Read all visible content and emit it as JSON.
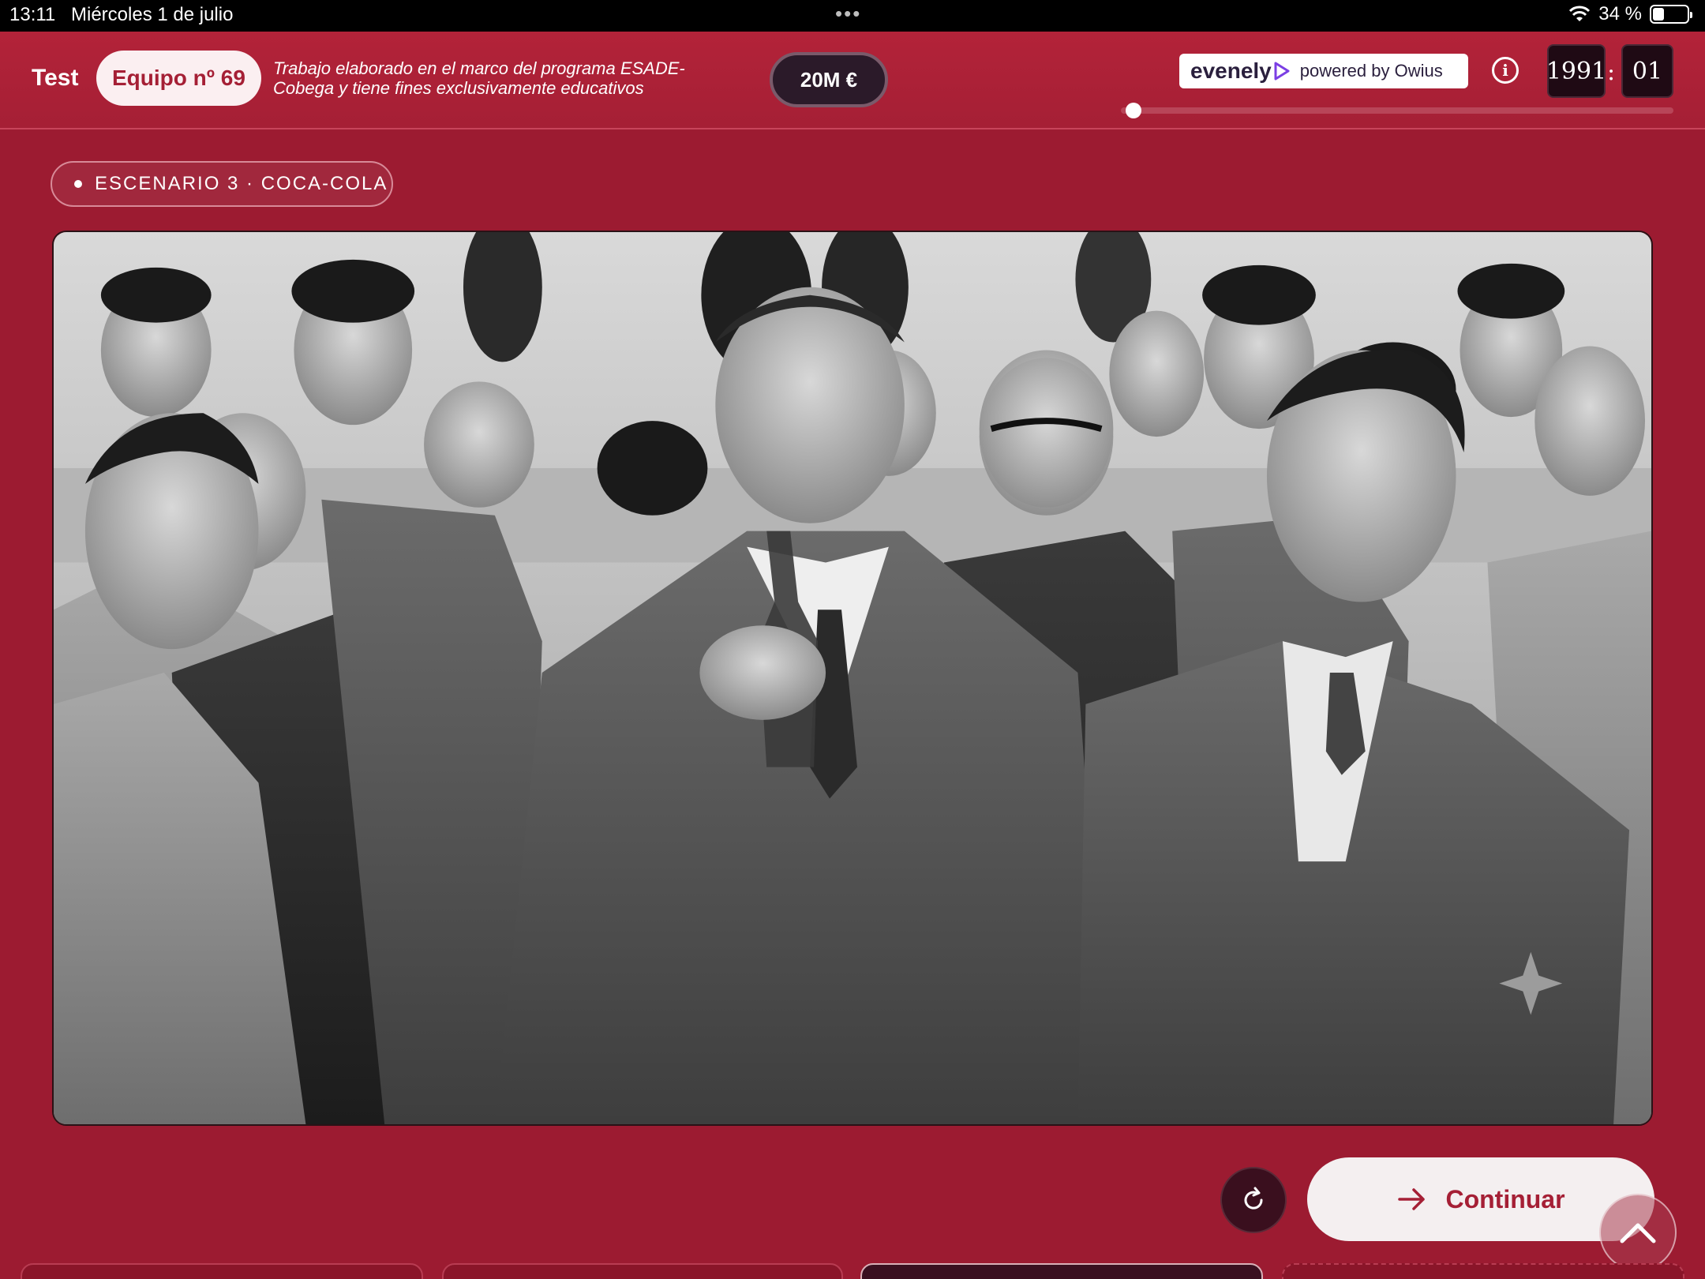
{
  "status_bar": {
    "time": "13:11",
    "date": "Miércoles 1 de julio",
    "more_dots": "•••",
    "battery": "34 %",
    "battery_level": 0.34
  },
  "header": {
    "test_label": "Test",
    "team": "Equipo nº 69",
    "disclaimer": "Trabajo elaborado en el marco del programa ESADE-Cobega y tiene fines exclusivamente educativos",
    "budget": "20M €",
    "brand_name": "evenely",
    "brand_powered": "powered by Owius",
    "info_icon": "i",
    "year": "1991",
    "separator": ":",
    "month": "01",
    "timeline_progress": 0.0
  },
  "scenario_tag": "ESCENARIO 3 · COCA-COLA",
  "controls": {
    "continue_label": "Continuar"
  },
  "icons": {
    "wifi": "wifi-icon",
    "battery": "battery-icon",
    "info": "info-icon",
    "brand": "play-arrow-logo-icon",
    "refresh": "refresh-icon",
    "continue": "arrow-right-icon",
    "scroll_top": "chevron-up-icon"
  },
  "colors": {
    "background": "#9c1b31",
    "accent": "#a51f35",
    "pill_bg": "#fbeff1",
    "dark": "#1f0a14"
  }
}
